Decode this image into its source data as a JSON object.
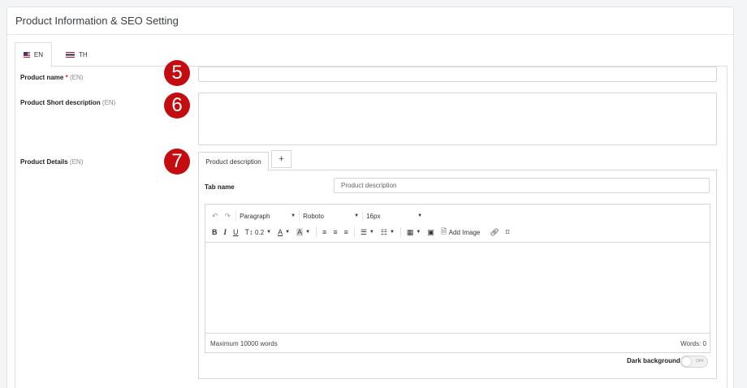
{
  "card": {
    "title": "Product Information & SEO Setting"
  },
  "lang_tabs": [
    {
      "label": "EN",
      "flag": "us-flag-icon",
      "active": true
    },
    {
      "label": "TH",
      "flag": "thailand-flag-icon",
      "active": false
    }
  ],
  "fields": {
    "product_name": {
      "label": "Product name",
      "required": "*",
      "lang": "(EN)",
      "badge": "5",
      "value": ""
    },
    "short_description": {
      "label": "Product Short description",
      "lang": "(EN)",
      "badge": "6",
      "value": ""
    },
    "details": {
      "label": "Product Details",
      "lang": "(EN)",
      "badge": "7"
    }
  },
  "details_tabs": {
    "active_tab": "Product description",
    "add_label": "+"
  },
  "tab_name": {
    "label": "Tab name",
    "value": "Product description"
  },
  "editor": {
    "paragraph_select": "Paragraph",
    "font_select": "Roboto",
    "size_select": "16px",
    "line_height": "0.2",
    "add_image_label": "Add Image",
    "status_left": "Maximum 10000 words",
    "status_right": "Words: 0"
  },
  "dark_background": {
    "label": "Dark background",
    "toggle_state": "OFF"
  },
  "colors": {
    "badge": "#c40d10",
    "required": "#e02020"
  }
}
